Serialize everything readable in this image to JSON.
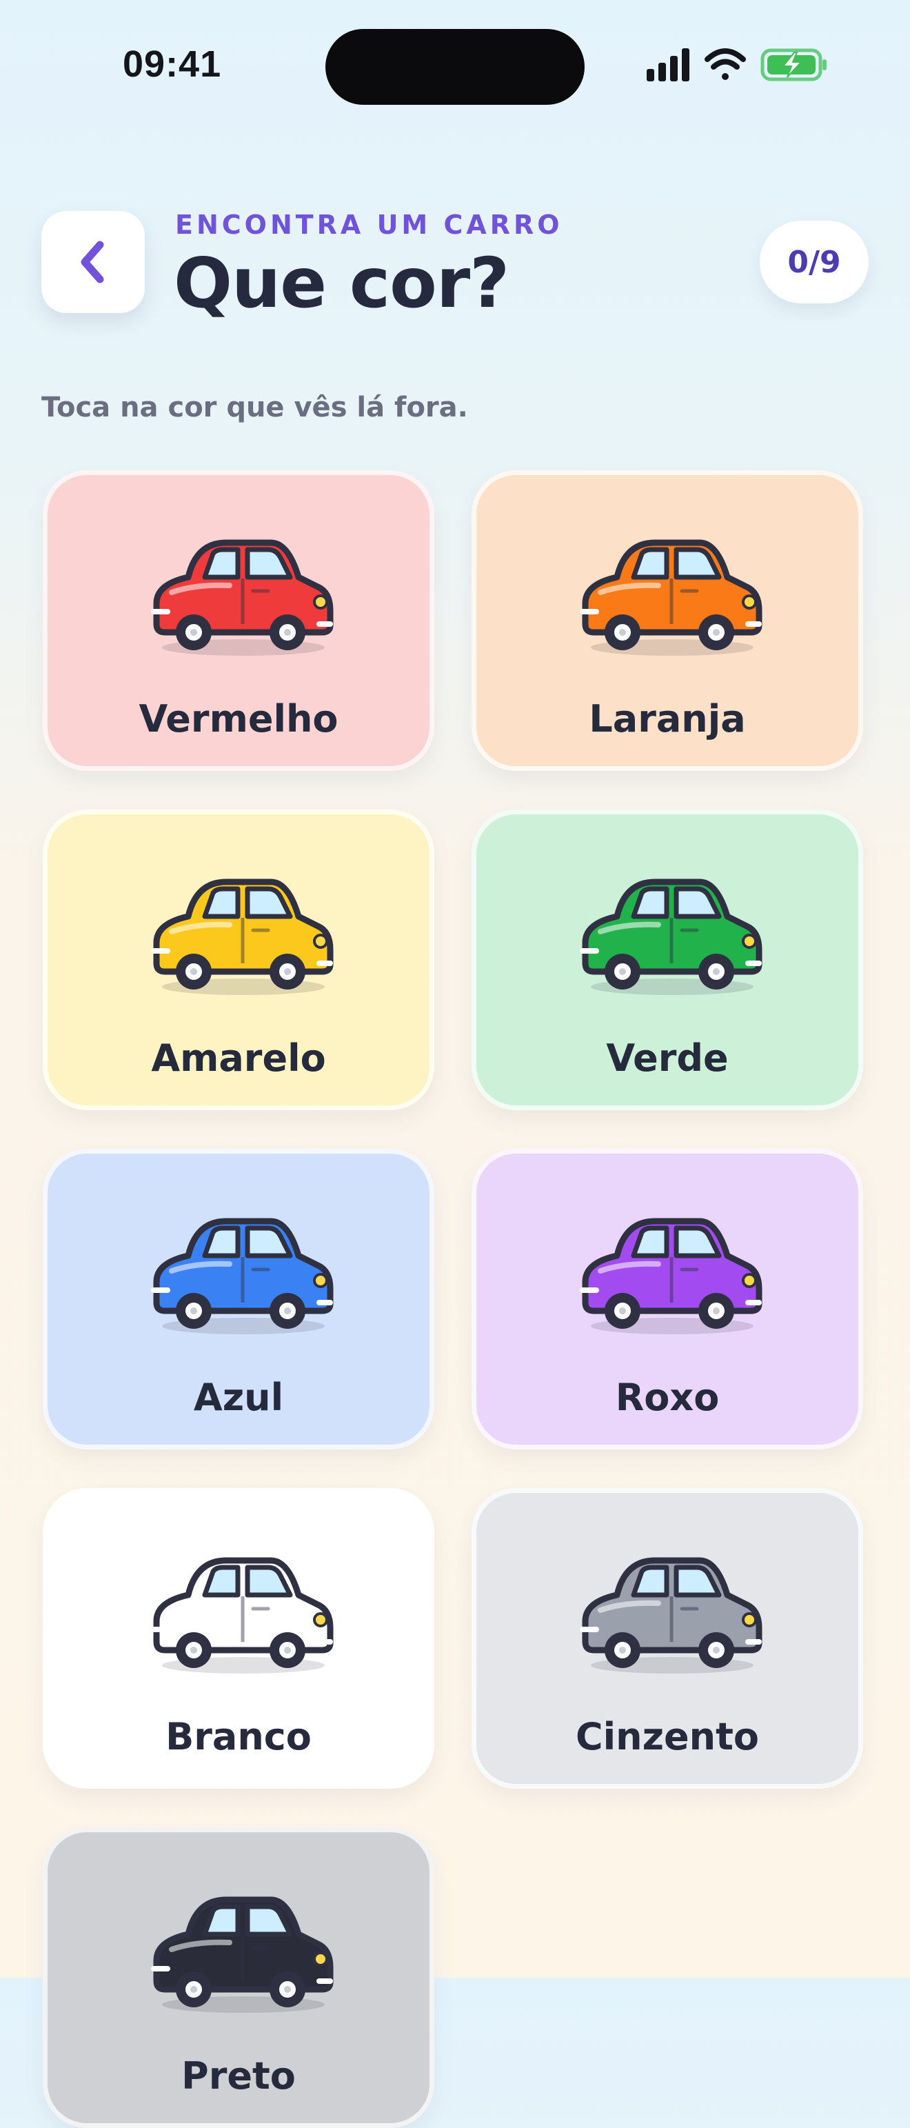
{
  "status": {
    "time": "09:41"
  },
  "header": {
    "eyebrow": "ENCONTRA UM CARRO",
    "title": "Que cor?",
    "counter": "0/9"
  },
  "subtitle": "Toca na cor que vês lá fora.",
  "colors": [
    {
      "label": "Vermelho",
      "tile_bg": "#fbd3d3",
      "car": "#ef3b3b"
    },
    {
      "label": "Laranja",
      "tile_bg": "#fde0c8",
      "car": "#f97a16"
    },
    {
      "label": "Amarelo",
      "tile_bg": "#fef3c2",
      "car": "#fcc81b"
    },
    {
      "label": "Verde",
      "tile_bg": "#ccf0d8",
      "car": "#22b24c"
    },
    {
      "label": "Azul",
      "tile_bg": "#d2e1fb",
      "car": "#3a82f4"
    },
    {
      "label": "Roxo",
      "tile_bg": "#ead6fb",
      "car": "#a24bf0"
    },
    {
      "label": "Branco",
      "tile_bg": "#ffffff",
      "car": "#ffffff"
    },
    {
      "label": "Cinzento",
      "tile_bg": "#e4e6ea",
      "car": "#9aa1ad"
    },
    {
      "label": "Preto",
      "tile_bg": "#cfd0d4",
      "car": "#2a2c3a"
    }
  ],
  "icons": {
    "back": "chevron-left-icon",
    "signal": "signal-icon",
    "wifi": "wifi-icon",
    "battery": "battery-charging-icon"
  },
  "accent": "#7153d9"
}
